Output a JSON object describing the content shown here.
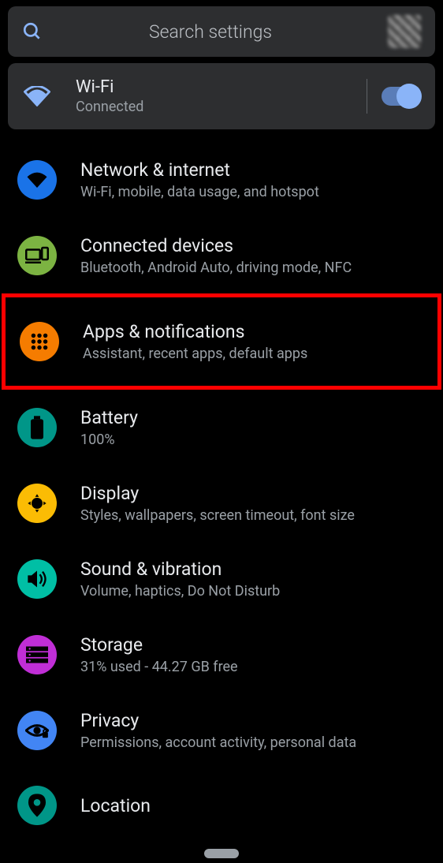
{
  "search": {
    "placeholder": "Search settings"
  },
  "wifi_card": {
    "title": "Wi-Fi",
    "status": "Connected",
    "toggle_on": true
  },
  "items": [
    {
      "title": "Network & internet",
      "subtitle": "Wi-Fi, mobile, data usage, and hotspot",
      "color": "#1a73e8",
      "icon": "wifi"
    },
    {
      "title": "Connected devices",
      "subtitle": "Bluetooth, Android Auto, driving mode, NFC",
      "color": "#7cb342",
      "icon": "devices"
    },
    {
      "title": "Apps & notifications",
      "subtitle": "Assistant, recent apps, default apps",
      "color": "#f57c00",
      "icon": "apps",
      "highlighted": true
    },
    {
      "title": "Battery",
      "subtitle": "100%",
      "color": "#009688",
      "icon": "battery"
    },
    {
      "title": "Display",
      "subtitle": "Styles, wallpapers, screen timeout, font size",
      "color": "#fbbc04",
      "icon": "brightness"
    },
    {
      "title": "Sound & vibration",
      "subtitle": "Volume, haptics, Do Not Disturb",
      "color": "#00bfa5",
      "icon": "sound"
    },
    {
      "title": "Storage",
      "subtitle": "31% used - 44.27 GB free",
      "color": "#c02ed6",
      "icon": "storage"
    },
    {
      "title": "Privacy",
      "subtitle": "Permissions, account activity, personal data",
      "color": "#4285f4",
      "icon": "privacy"
    },
    {
      "title": "Location",
      "subtitle": "",
      "color": "#009688",
      "icon": "location"
    }
  ]
}
